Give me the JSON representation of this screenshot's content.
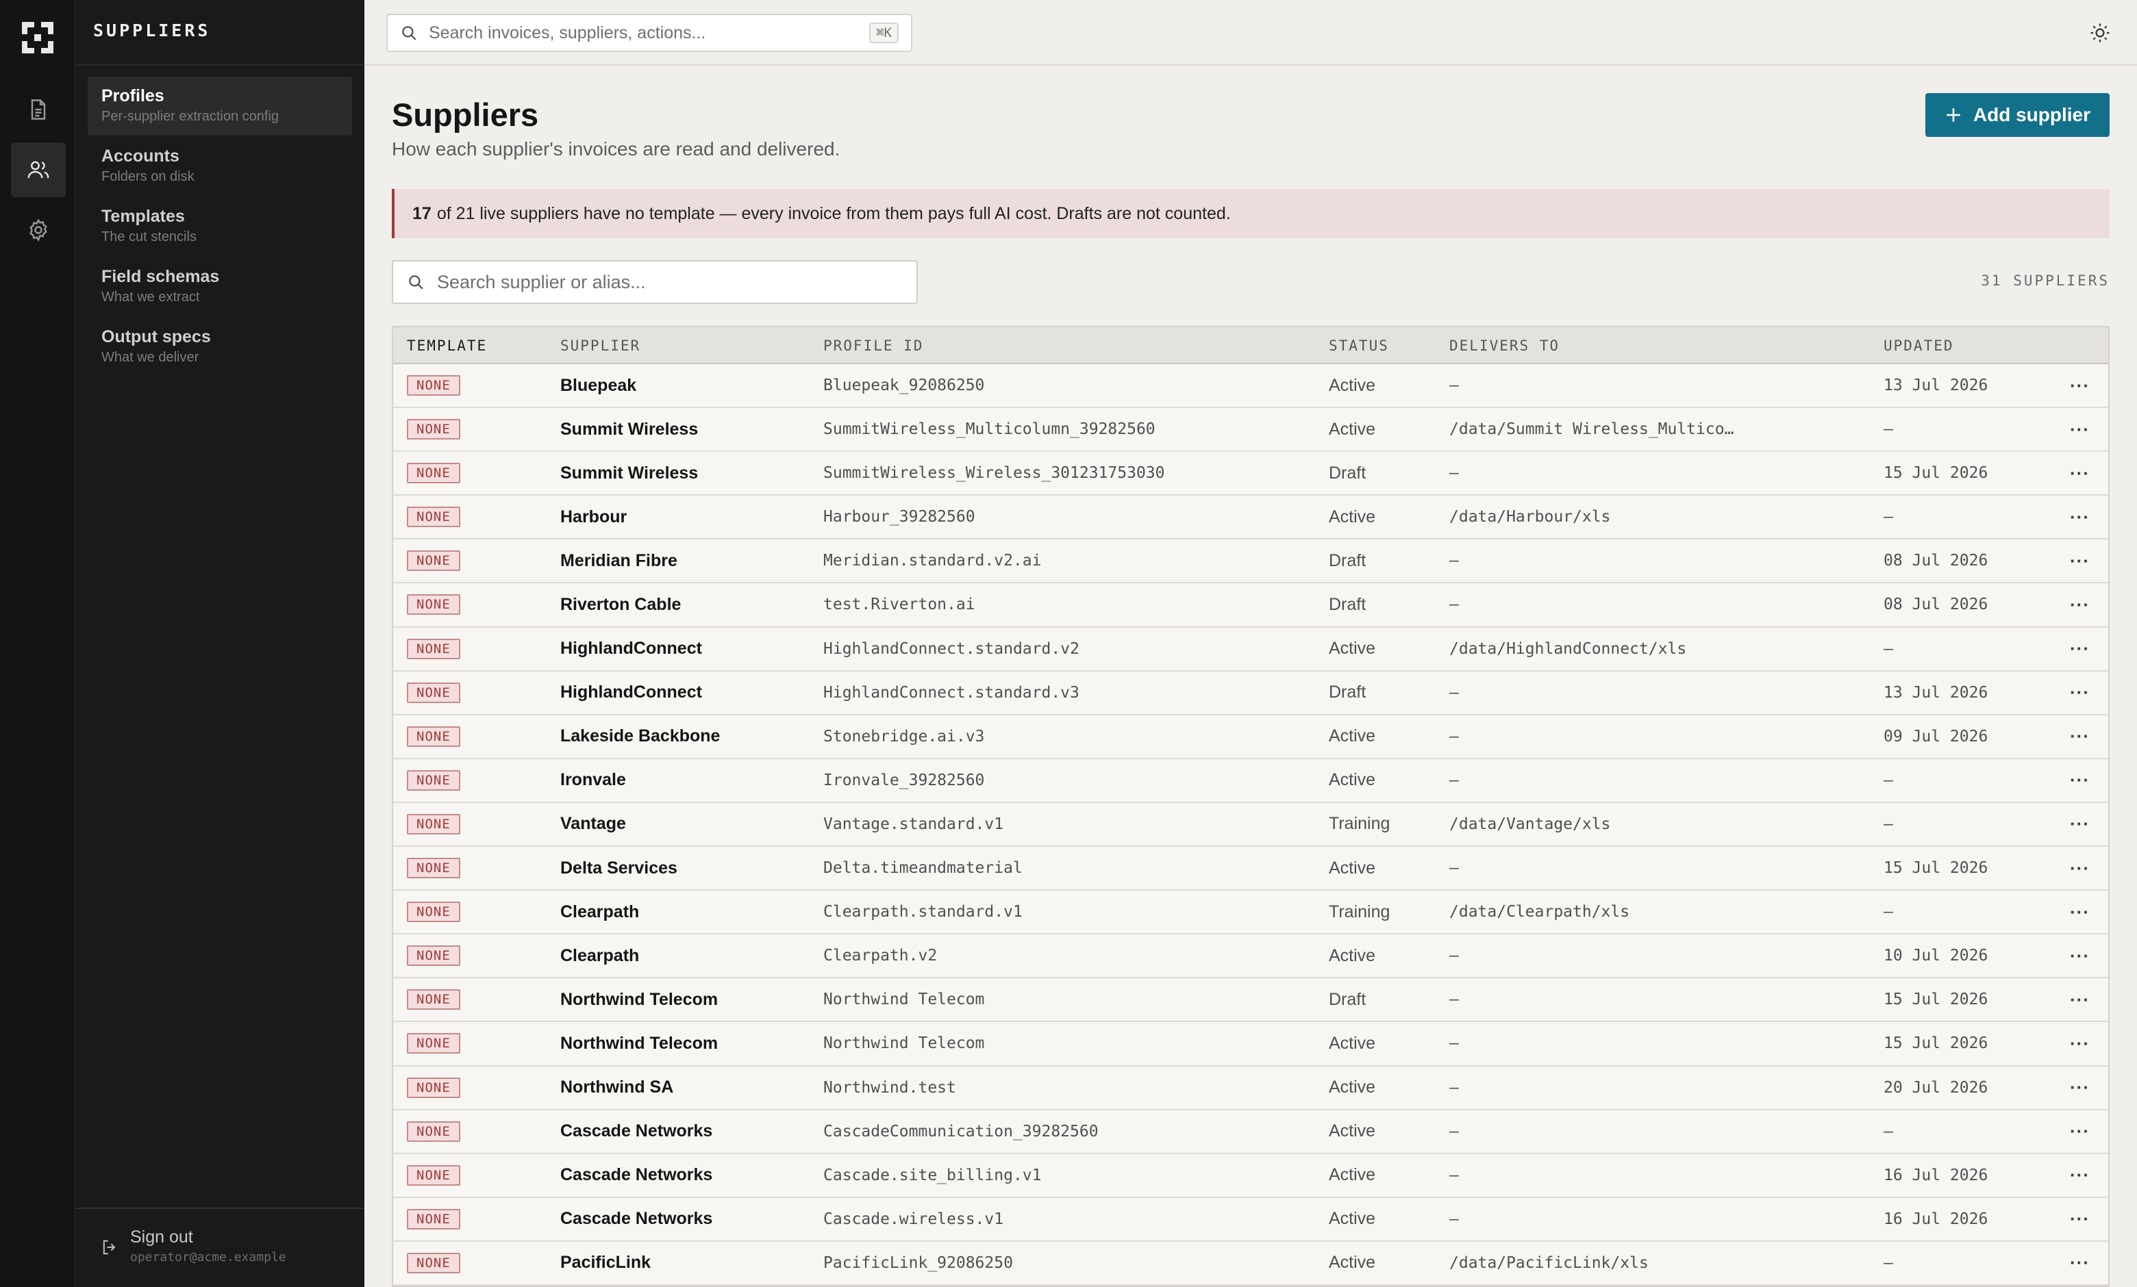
{
  "sidebar": {
    "title": "SUPPLIERS",
    "items": [
      {
        "label": "Profiles",
        "sub": "Per-supplier extraction config"
      },
      {
        "label": "Accounts",
        "sub": "Folders on disk"
      },
      {
        "label": "Templates",
        "sub": "The cut stencils"
      },
      {
        "label": "Field schemas",
        "sub": "What we extract"
      },
      {
        "label": "Output specs",
        "sub": "What we deliver"
      }
    ],
    "signout": {
      "label": "Sign out",
      "email": "operator@acme.example"
    }
  },
  "topbar": {
    "search_placeholder": "Search invoices, suppliers, actions...",
    "shortcut": "⌘K"
  },
  "page": {
    "title": "Suppliers",
    "subtitle": "How each supplier's invoices are read and delivered.",
    "add_button": "Add supplier"
  },
  "alert": {
    "count": "17",
    "text": "of 21 live suppliers have no template — every invoice from them pays full AI cost. Drafts are not counted."
  },
  "table_search": {
    "placeholder": "Search supplier or alias..."
  },
  "supplier_count": "31 SUPPLIERS",
  "columns": {
    "template": "TEMPLATE",
    "supplier": "SUPPLIER",
    "profile_id": "PROFILE ID",
    "status": "STATUS",
    "delivers_to": "DELIVERS TO",
    "updated": "UPDATED"
  },
  "rows": [
    {
      "template": "NONE",
      "supplier": "Bluepeak",
      "profile_id": "Bluepeak_92086250",
      "status": "Active",
      "delivers_to": "–",
      "updated": "13 Jul 2026"
    },
    {
      "template": "NONE",
      "supplier": "Summit Wireless",
      "profile_id": "SummitWireless_Multicolumn_39282560",
      "status": "Active",
      "delivers_to": "/data/Summit Wireless_Multico…",
      "updated": "–"
    },
    {
      "template": "NONE",
      "supplier": "Summit Wireless",
      "profile_id": "SummitWireless_Wireless_301231753030",
      "status": "Draft",
      "delivers_to": "–",
      "updated": "15 Jul 2026"
    },
    {
      "template": "NONE",
      "supplier": "Harbour",
      "profile_id": "Harbour_39282560",
      "status": "Active",
      "delivers_to": "/data/Harbour/xls",
      "updated": "–"
    },
    {
      "template": "NONE",
      "supplier": "Meridian Fibre",
      "profile_id": "Meridian.standard.v2.ai",
      "status": "Draft",
      "delivers_to": "–",
      "updated": "08 Jul 2026"
    },
    {
      "template": "NONE",
      "supplier": "Riverton Cable",
      "profile_id": "test.Riverton.ai",
      "status": "Draft",
      "delivers_to": "–",
      "updated": "08 Jul 2026"
    },
    {
      "template": "NONE",
      "supplier": "HighlandConnect",
      "profile_id": "HighlandConnect.standard.v2",
      "status": "Active",
      "delivers_to": "/data/HighlandConnect/xls",
      "updated": "–"
    },
    {
      "template": "NONE",
      "supplier": "HighlandConnect",
      "profile_id": "HighlandConnect.standard.v3",
      "status": "Draft",
      "delivers_to": "–",
      "updated": "13 Jul 2026"
    },
    {
      "template": "NONE",
      "supplier": "Lakeside Backbone",
      "profile_id": "Stonebridge.ai.v3",
      "status": "Active",
      "delivers_to": "–",
      "updated": "09 Jul 2026"
    },
    {
      "template": "NONE",
      "supplier": "Ironvale",
      "profile_id": "Ironvale_39282560",
      "status": "Active",
      "delivers_to": "–",
      "updated": "–"
    },
    {
      "template": "NONE",
      "supplier": "Vantage",
      "profile_id": "Vantage.standard.v1",
      "status": "Training",
      "delivers_to": "/data/Vantage/xls",
      "updated": "–"
    },
    {
      "template": "NONE",
      "supplier": "Delta Services",
      "profile_id": "Delta.timeandmaterial",
      "status": "Active",
      "delivers_to": "–",
      "updated": "15 Jul 2026"
    },
    {
      "template": "NONE",
      "supplier": "Clearpath",
      "profile_id": "Clearpath.standard.v1",
      "status": "Training",
      "delivers_to": "/data/Clearpath/xls",
      "updated": "–"
    },
    {
      "template": "NONE",
      "supplier": "Clearpath",
      "profile_id": "Clearpath.v2",
      "status": "Active",
      "delivers_to": "–",
      "updated": "10 Jul 2026"
    },
    {
      "template": "NONE",
      "supplier": "Northwind Telecom",
      "profile_id": "Northwind Telecom",
      "status": "Draft",
      "delivers_to": "–",
      "updated": "15 Jul 2026"
    },
    {
      "template": "NONE",
      "supplier": "Northwind Telecom",
      "profile_id": "Northwind Telecom",
      "status": "Active",
      "delivers_to": "–",
      "updated": "15 Jul 2026"
    },
    {
      "template": "NONE",
      "supplier": "Northwind SA",
      "profile_id": "Northwind.test",
      "status": "Active",
      "delivers_to": "–",
      "updated": "20 Jul 2026"
    },
    {
      "template": "NONE",
      "supplier": "Cascade Networks",
      "profile_id": "CascadeCommunication_39282560",
      "status": "Active",
      "delivers_to": "–",
      "updated": "–"
    },
    {
      "template": "NONE",
      "supplier": "Cascade Networks",
      "profile_id": "Cascade.site_billing.v1",
      "status": "Active",
      "delivers_to": "–",
      "updated": "16 Jul 2026"
    },
    {
      "template": "NONE",
      "supplier": "Cascade Networks",
      "profile_id": "Cascade.wireless.v1",
      "status": "Active",
      "delivers_to": "–",
      "updated": "16 Jul 2026"
    },
    {
      "template": "NONE",
      "supplier": "PacificLink",
      "profile_id": "PacificLink_92086250",
      "status": "Active",
      "delivers_to": "/data/PacificLink/xls",
      "updated": "–"
    }
  ],
  "row_action": "···"
}
